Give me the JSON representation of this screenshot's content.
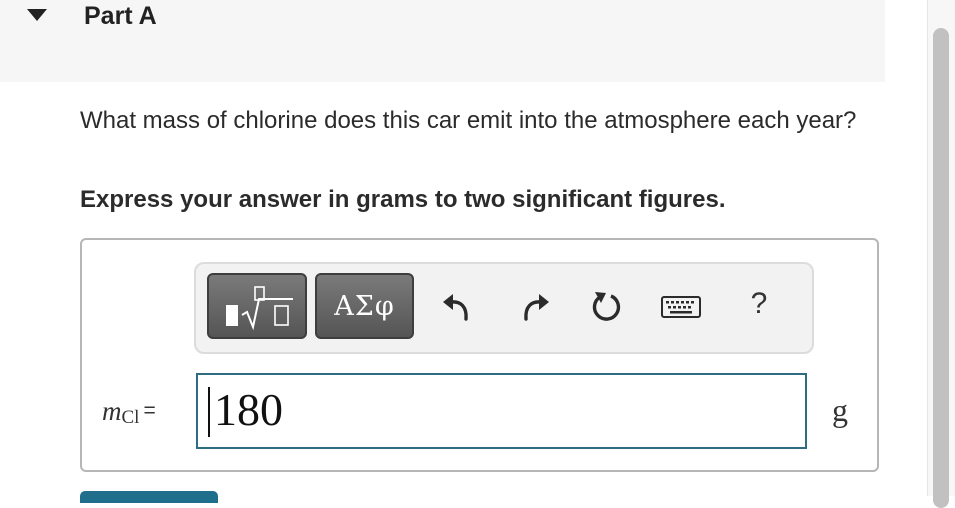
{
  "part": {
    "title": "Part A"
  },
  "question": {
    "text": "What mass of chlorine does this car emit into the atmosphere each year?",
    "instruction": "Express your answer in grams to two significant figures."
  },
  "toolbar": {
    "greek_label": "ΑΣφ",
    "help_label": "?",
    "icons": [
      "templates-icon",
      "undo-icon",
      "redo-icon",
      "reset-icon",
      "keyboard-icon",
      "help-icon"
    ]
  },
  "answer": {
    "variable": "m",
    "subscript": "Cl",
    "equals": "=",
    "value": "180",
    "unit": "g"
  },
  "colors": {
    "input_border": "#2e6c82",
    "toolbar_button": "#666666",
    "submit_button": "#1f6e8c"
  }
}
